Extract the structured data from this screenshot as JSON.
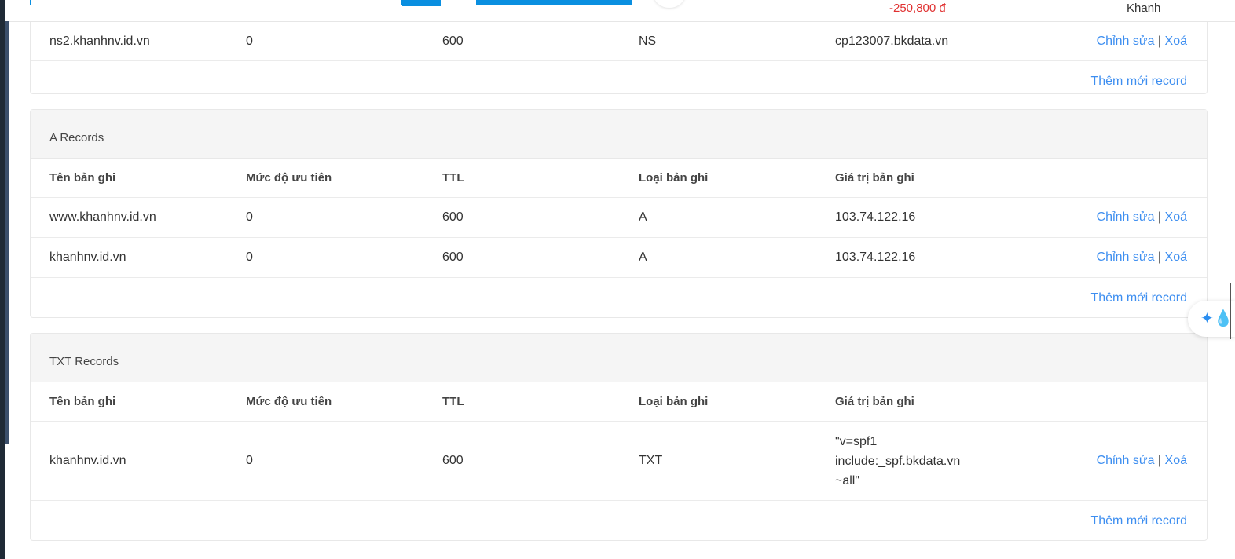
{
  "topbar": {
    "balance": "-250,800 đ",
    "user": "Khanh"
  },
  "columns": [
    "Tên bản ghi",
    "Mức độ ưu tiên",
    "TTL",
    "Loại bản ghi",
    "Giá trị bản ghi"
  ],
  "actions": {
    "edit": "Chỉnh sửa",
    "sep": "|",
    "delete": "Xoá",
    "add": "Thêm mới record"
  },
  "ns": {
    "rows": [
      {
        "name": "ns2.khanhnv.id.vn",
        "priority": "0",
        "ttl": "600",
        "type": "NS",
        "value": "cp123007.bkdata.vn"
      }
    ]
  },
  "a": {
    "title": "A Records",
    "rows": [
      {
        "name": "www.khanhnv.id.vn",
        "priority": "0",
        "ttl": "600",
        "type": "A",
        "value": "103.74.122.16"
      },
      {
        "name": "khanhnv.id.vn",
        "priority": "0",
        "ttl": "600",
        "type": "A",
        "value": "103.74.122.16"
      }
    ]
  },
  "txt": {
    "title": "TXT Records",
    "rows": [
      {
        "name": "khanhnv.id.vn",
        "priority": "0",
        "ttl": "600",
        "type": "TXT",
        "value": "\"v=spf1 include:_spf.bkdata.vn ~all\""
      }
    ]
  },
  "colors": {
    "accent": "#0a8fe0",
    "link": "#3d8ef0",
    "negative": "#e03131"
  }
}
